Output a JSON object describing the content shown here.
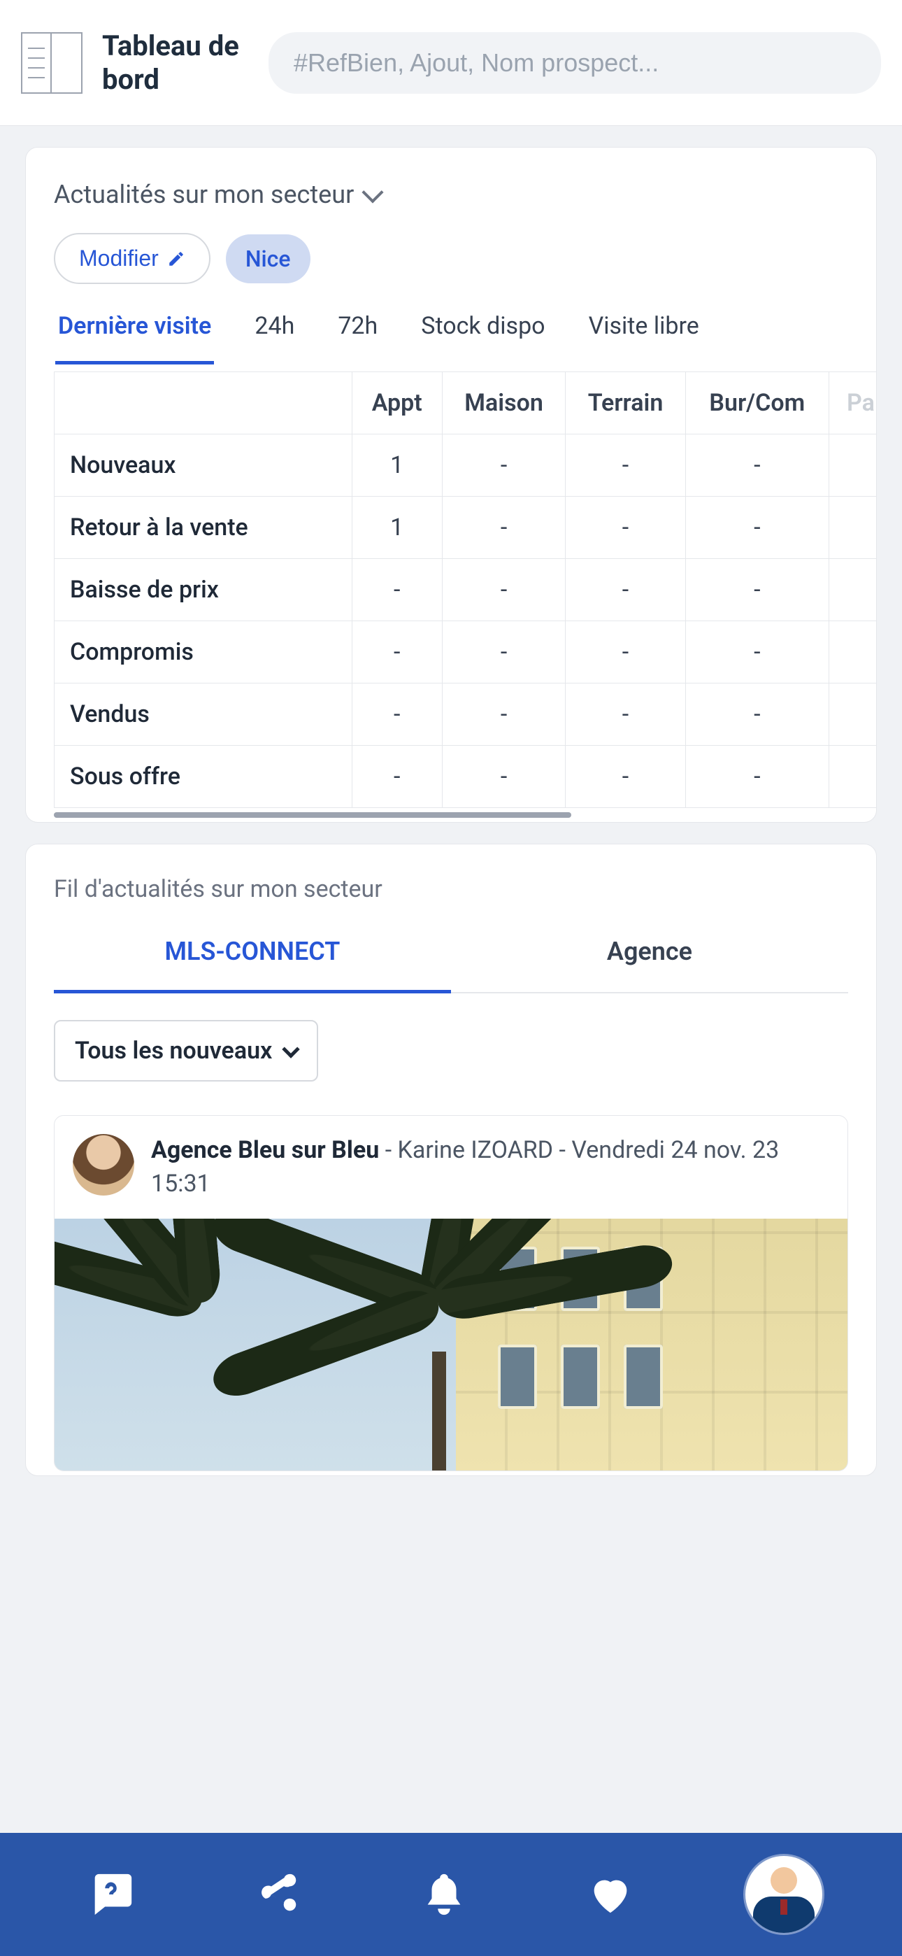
{
  "header": {
    "title": "Tableau de bord",
    "search_placeholder": "#RefBien, Ajout, Nom prospect..."
  },
  "news": {
    "sector_title": "Actualités sur mon secteur",
    "modify_label": "Modifier",
    "location_chip": "Nice",
    "time_tabs": [
      "Dernière visite",
      "24h",
      "72h",
      "Stock dispo",
      "Visite libre"
    ],
    "active_time_tab": 0,
    "columns": [
      "Appt",
      "Maison",
      "Terrain",
      "Bur/Com",
      "Pa"
    ],
    "rows": [
      {
        "label": "Nouveaux",
        "values": [
          "1",
          "-",
          "-",
          "-"
        ]
      },
      {
        "label": "Retour à la vente",
        "values": [
          "1",
          "-",
          "-",
          "-"
        ]
      },
      {
        "label": "Baisse de prix",
        "values": [
          "-",
          "-",
          "-",
          "-"
        ]
      },
      {
        "label": "Compromis",
        "values": [
          "-",
          "-",
          "-",
          "-"
        ]
      },
      {
        "label": "Vendus",
        "values": [
          "-",
          "-",
          "-",
          "-"
        ]
      },
      {
        "label": "Sous offre",
        "values": [
          "-",
          "-",
          "-",
          "-"
        ]
      }
    ]
  },
  "feed": {
    "title": "Fil d'actualités sur mon secteur",
    "tabs": [
      "MLS-CONNECT",
      "Agence"
    ],
    "active_tab": 0,
    "filter_label": "Tous les nouveaux",
    "post": {
      "agency": "Agence Bleu sur Bleu",
      "sep1": " - ",
      "author": "Karine IZOARD",
      "sep2": " - ",
      "datetime": "Vendredi 24 nov. 23 15:31"
    }
  },
  "bottom_nav": {
    "items": [
      "help",
      "share",
      "notifications",
      "favorites",
      "profile"
    ]
  }
}
